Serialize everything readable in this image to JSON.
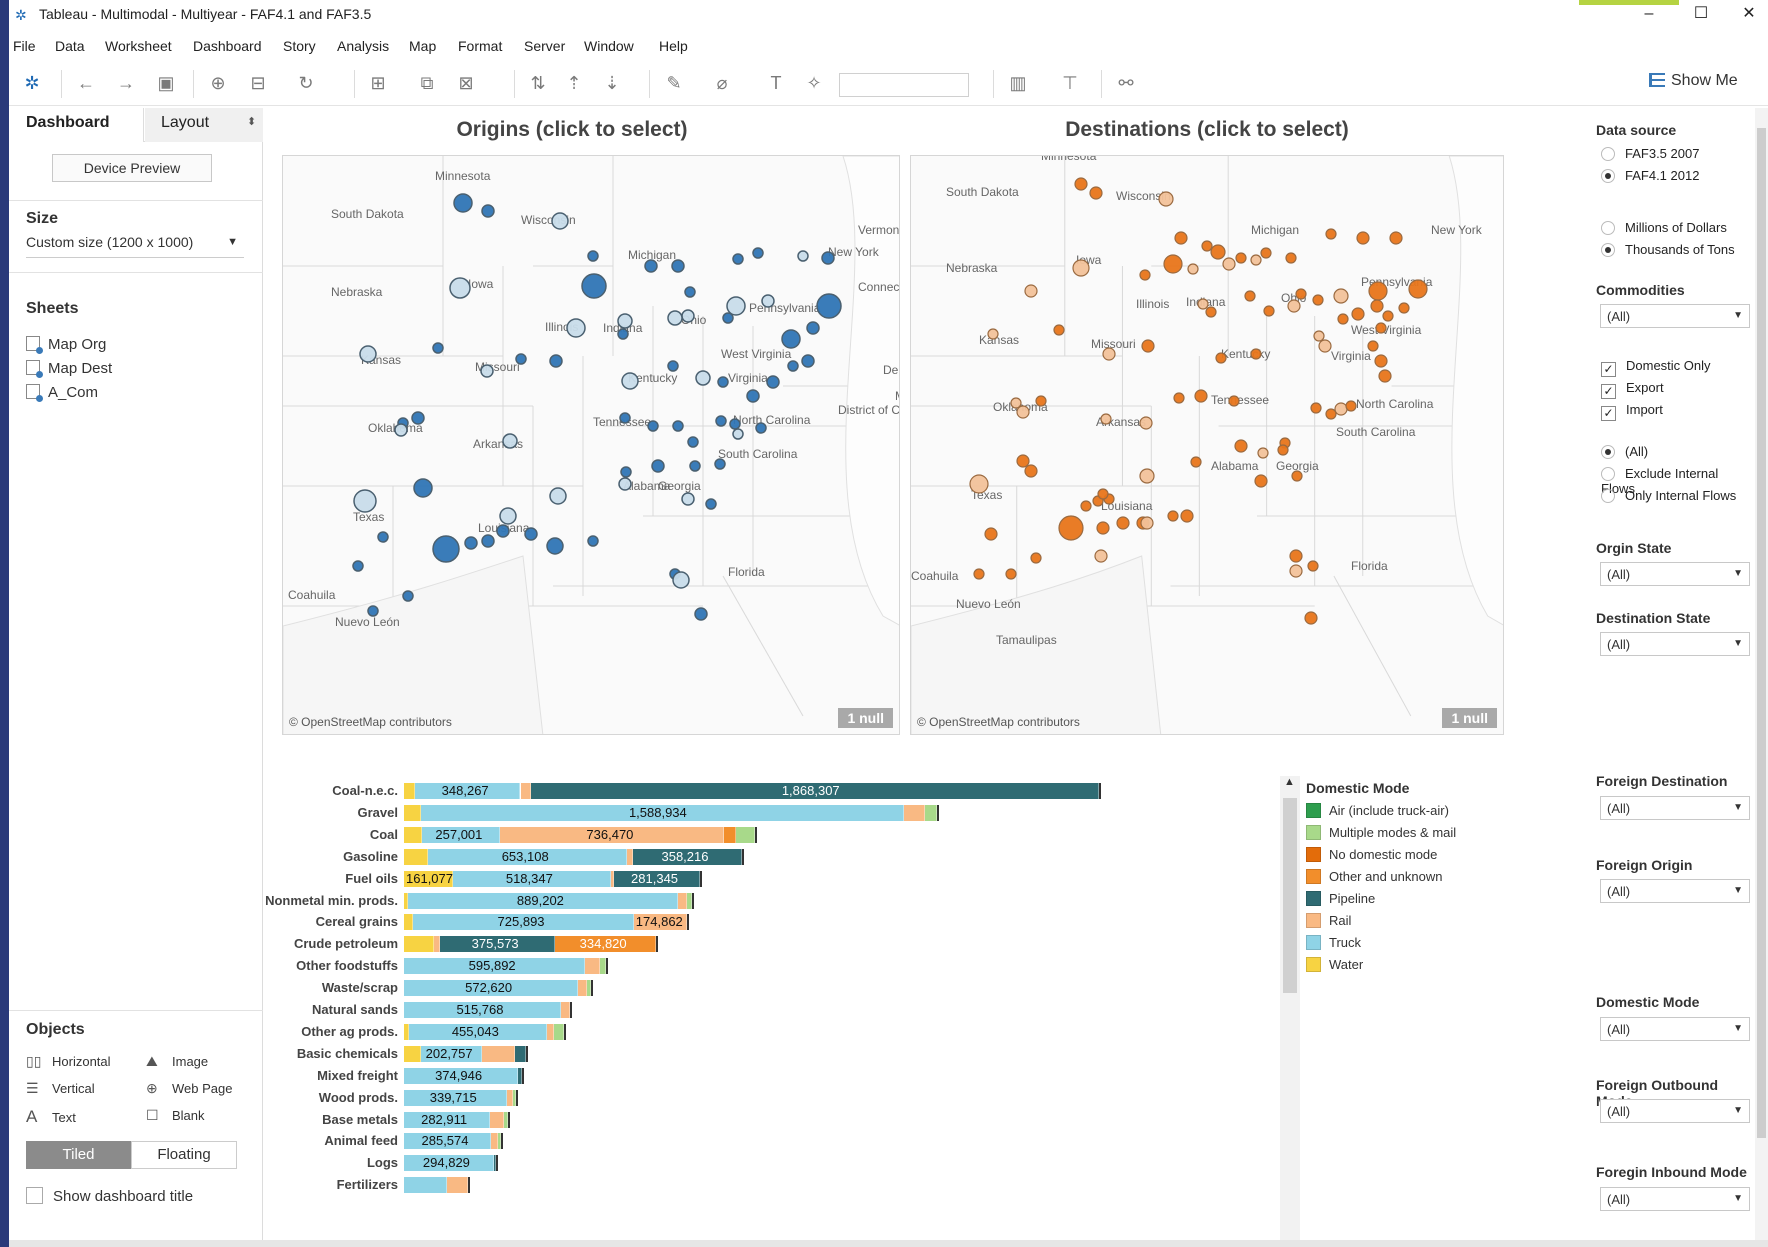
{
  "window": {
    "title": "Tableau - Multimodal - Multiyear - FAF4.1 and FAF3.5",
    "minimize": "–",
    "maximize": "☐",
    "close": "✕"
  },
  "menu": [
    "File",
    "Data",
    "Worksheet",
    "Dashboard",
    "Story",
    "Analysis",
    "Map",
    "Format",
    "Server",
    "Window",
    "Help"
  ],
  "toolbar": {
    "show_me": "Show Me"
  },
  "left_panel": {
    "tab_dashboard": "Dashboard",
    "tab_layout": "Layout",
    "device_preview": "Device Preview",
    "size_heading": "Size",
    "size_value": "Custom size (1200 x 1000)",
    "sheets_heading": "Sheets",
    "sheets": [
      "Map Org",
      "Map Dest",
      "A_Com"
    ],
    "objects_heading": "Objects",
    "objects": {
      "horizontal": "Horizontal",
      "image": "Image",
      "vertical": "Vertical",
      "web_page": "Web Page",
      "text": "Text",
      "blank": "Blank"
    },
    "tiled": "Tiled",
    "floating": "Floating",
    "show_title": "Show dashboard title"
  },
  "maps": {
    "origins_title": "Origins (click to select)",
    "destinations_title": "Destinations (click to select)",
    "attribution": "© OpenStreetMap contributors",
    "null_badge": "1 null",
    "origin_labels": [
      "Minnesota",
      "South Dakota",
      "Wisconsin",
      "Michigan",
      "New York",
      "Vermont",
      "Nebraska",
      "Iowa",
      "Illinois",
      "Indiana",
      "Ohio",
      "Pennsylvania",
      "Connecticut",
      "Kansas",
      "Missouri",
      "Kentucky",
      "West Virginia",
      "Virginia",
      "Delaware",
      "Maryland",
      "District of Columbia",
      "Oklahoma",
      "Arkansas",
      "Tennessee",
      "North Carolina",
      "South Carolina",
      "Texas",
      "Louisiana",
      "Alabama",
      "Georgia",
      "Florida",
      "Coahuila",
      "Nuevo León"
    ],
    "dest_labels": [
      "Minnesota",
      "South Dakota",
      "Wisconsin",
      "Michigan",
      "New York",
      "Nebraska",
      "Iowa",
      "Illinois",
      "Indiana",
      "Ohio",
      "Pennsylvania",
      "Kansas",
      "Missouri",
      "Kentucky",
      "West Virginia",
      "Virginia",
      "Oklahoma",
      "Arkansas",
      "Tennessee",
      "North Carolina",
      "South Carolina",
      "Texas",
      "Louisiana",
      "Alabama",
      "Georgia",
      "Florida",
      "Coahuila",
      "Nuevo León",
      "Tamaulipas"
    ]
  },
  "filters": {
    "data_source_heading": "Data source",
    "data_source_options": [
      "FAF3.5 2007",
      "FAF4.1 2012"
    ],
    "data_source_selected": "FAF4.1 2012",
    "measure_options": [
      "Millions of Dollars",
      "Thousands of Tons"
    ],
    "measure_selected": "Thousands of Tons",
    "commodities_heading": "Commodities",
    "commodities_value": "(All)",
    "trade_checks": [
      "Domestic Only",
      "Export",
      "Import"
    ],
    "flow_options": [
      "(All)",
      "Exclude Internal Flows",
      "Only Internal Flows"
    ],
    "flow_selected": "(All)",
    "origin_state_heading": "Orgin State",
    "origin_state_value": "(All)",
    "dest_state_heading": "Destination State",
    "dest_state_value": "(All)",
    "foreign_dest_heading": "Foreign Destination",
    "foreign_dest_value": "(All)",
    "foreign_origin_heading": "Foreign Origin",
    "foreign_origin_value": "(All)",
    "domestic_mode_heading": "Domestic Mode",
    "domestic_mode_value": "(All)",
    "foreign_outbound_heading": "Foreign Outbound Mode",
    "foreign_outbound_value": "(All)",
    "foreign_inbound_heading": "Foregin Inbound Mode",
    "foreign_inbound_value": "(All)"
  },
  "legend": {
    "title": "Domestic Mode",
    "items": [
      {
        "label": "Air (include truck-air)",
        "color": "#2e9e4e"
      },
      {
        "label": "Multiple modes & mail",
        "color": "#a8d98a"
      },
      {
        "label": "No domestic mode",
        "color": "#e36c0a"
      },
      {
        "label": "Other and unknown",
        "color": "#f28e2b"
      },
      {
        "label": "Pipeline",
        "color": "#2f6b73"
      },
      {
        "label": "Rail",
        "color": "#f9b983"
      },
      {
        "label": "Truck",
        "color": "#8fd3e6"
      },
      {
        "label": "Water",
        "color": "#f7d342"
      }
    ]
  },
  "chart_data": {
    "type": "bar",
    "orientation": "horizontal",
    "stacked": true,
    "xlim": [
      0,
      2500000
    ],
    "categories": [
      "Coal-n.e.c.",
      "Gravel",
      "Coal",
      "Gasoline",
      "Fuel oils",
      "Nonmetal min. prods.",
      "Cereal grains",
      "Crude petroleum",
      "Other foodstuffs",
      "Waste/scrap",
      "Natural sands",
      "Other ag prods.",
      "Basic chemicals",
      "Mixed freight",
      "Wood prods.",
      "Base metals",
      "Animal feed",
      "Logs",
      "Fertilizers"
    ],
    "rows": [
      {
        "category": "Coal-n.e.c.",
        "segments": [
          [
            "Water",
            35000,
            null
          ],
          [
            "Truck",
            348267,
            "348,267"
          ],
          [
            "Rail",
            35000,
            null
          ],
          [
            "Pipeline",
            1868307,
            "1,868,307"
          ]
        ]
      },
      {
        "category": "Gravel",
        "segments": [
          [
            "Water",
            55000,
            null
          ],
          [
            "Truck",
            1588934,
            "1,588,934"
          ],
          [
            "Rail",
            70000,
            null
          ],
          [
            "Multiple modes & mail",
            40000,
            null
          ]
        ]
      },
      {
        "category": "Coal",
        "segments": [
          [
            "Water",
            60000,
            null
          ],
          [
            "Truck",
            257001,
            "257,001"
          ],
          [
            "Rail",
            736470,
            "736,470"
          ],
          [
            "Other and unknown",
            40000,
            null
          ],
          [
            "Multiple modes & mail",
            60000,
            null
          ]
        ]
      },
      {
        "category": "Gasoline",
        "segments": [
          [
            "Water",
            80000,
            null
          ],
          [
            "Truck",
            653108,
            "653,108"
          ],
          [
            "Rail",
            20000,
            null
          ],
          [
            "Pipeline",
            358216,
            "358,216"
          ]
        ]
      },
      {
        "category": "Fuel oils",
        "segments": [
          [
            "Water",
            161077,
            "161,077"
          ],
          [
            "Truck",
            518347,
            "518,347"
          ],
          [
            "Rail",
            12000,
            null
          ],
          [
            "Pipeline",
            281345,
            "281,345"
          ]
        ]
      },
      {
        "category": "Nonmetal min. prods.",
        "segments": [
          [
            "Water",
            12000,
            null
          ],
          [
            "Truck",
            889202,
            "889,202"
          ],
          [
            "Rail",
            30000,
            null
          ],
          [
            "Multiple modes & mail",
            15000,
            null
          ]
        ]
      },
      {
        "category": "Cereal grains",
        "segments": [
          [
            "Water",
            30000,
            null
          ],
          [
            "Truck",
            725893,
            "725,893"
          ],
          [
            "Rail",
            174862,
            "174,862"
          ]
        ]
      },
      {
        "category": "Crude petroleum",
        "segments": [
          [
            "Water",
            100000,
            null
          ],
          [
            "Rail",
            20000,
            null
          ],
          [
            "Pipeline",
            375573,
            "375,573"
          ],
          [
            "Other and unknown",
            334820,
            "334,820"
          ]
        ]
      },
      {
        "category": "Other foodstuffs",
        "segments": [
          [
            "Truck",
            595892,
            "595,892"
          ],
          [
            "Rail",
            48000,
            null
          ],
          [
            "Multiple modes & mail",
            22000,
            null
          ]
        ]
      },
      {
        "category": "Waste/scrap",
        "segments": [
          [
            "Truck",
            572620,
            "572,620"
          ],
          [
            "Rail",
            30000,
            null
          ],
          [
            "Multiple modes & mail",
            12000,
            null
          ]
        ]
      },
      {
        "category": "Natural sands",
        "segments": [
          [
            "Truck",
            515768,
            "515,768"
          ],
          [
            "Rail",
            30000,
            null
          ]
        ]
      },
      {
        "category": "Other ag prods.",
        "segments": [
          [
            "Water",
            15000,
            null
          ],
          [
            "Truck",
            455043,
            "455,043"
          ],
          [
            "Rail",
            25000,
            null
          ],
          [
            "Multiple modes & mail",
            30000,
            null
          ]
        ]
      },
      {
        "category": "Basic chemicals",
        "segments": [
          [
            "Water",
            55000,
            null
          ],
          [
            "Truck",
            202757,
            "202,757"
          ],
          [
            "Rail",
            108000,
            null
          ],
          [
            "Pipeline",
            35000,
            null
          ]
        ]
      },
      {
        "category": "Mixed freight",
        "segments": [
          [
            "Truck",
            374946,
            "374,946"
          ],
          [
            "Pipeline",
            12000,
            null
          ]
        ]
      },
      {
        "category": "Wood prods.",
        "segments": [
          [
            "Truck",
            339715,
            "339,715"
          ],
          [
            "Rail",
            20000,
            null
          ],
          [
            "Multiple modes & mail",
            10000,
            null
          ]
        ]
      },
      {
        "category": "Base metals",
        "segments": [
          [
            "Truck",
            282911,
            "282,911"
          ],
          [
            "Rail",
            45000,
            null
          ],
          [
            "Multiple modes & mail",
            15000,
            null
          ]
        ]
      },
      {
        "category": "Animal feed",
        "segments": [
          [
            "Truck",
            285574,
            "285,574"
          ],
          [
            "Rail",
            25000,
            null
          ],
          [
            "Multiple modes & mail",
            10000,
            null
          ]
        ]
      },
      {
        "category": "Logs",
        "segments": [
          [
            "Truck",
            294829,
            "294,829"
          ],
          [
            "Pipeline",
            5000,
            null
          ]
        ]
      },
      {
        "category": "Fertilizers",
        "segments": [
          [
            "Truck",
            140000,
            null
          ],
          [
            "Rail",
            70000,
            null
          ]
        ]
      }
    ]
  }
}
